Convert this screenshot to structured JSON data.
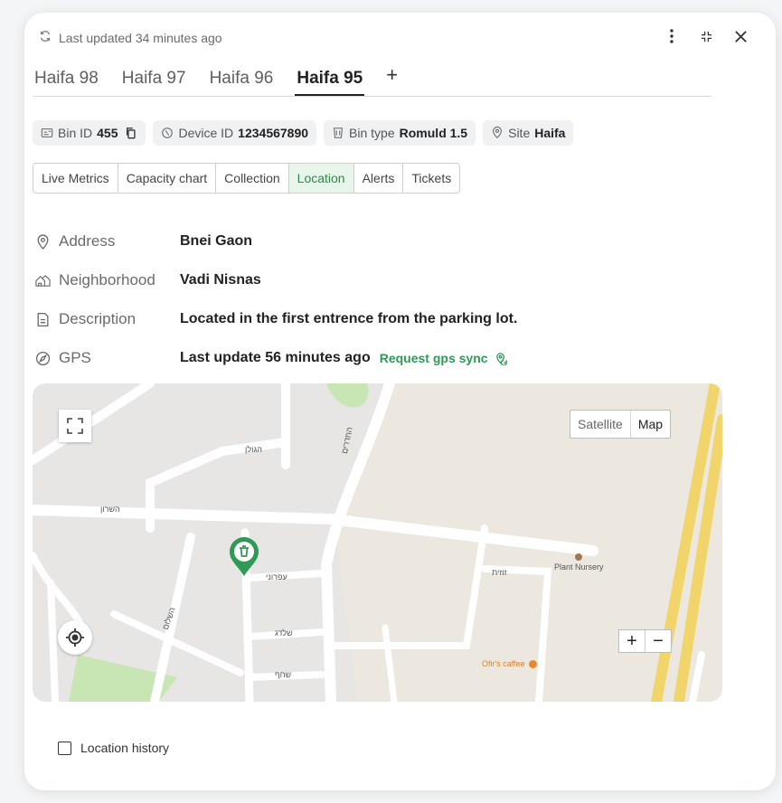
{
  "header": {
    "last_updated": "Last updated 34 minutes ago"
  },
  "tabs": [
    {
      "label": "Haifa 98"
    },
    {
      "label": "Haifa 97"
    },
    {
      "label": "Haifa 96"
    },
    {
      "label": "Haifa 95"
    }
  ],
  "tab_add_label": "+",
  "chips": {
    "bin_id_label": "Bin ID",
    "bin_id_value": "455",
    "device_id_label": "Device ID",
    "device_id_value": "1234567890",
    "bin_type_label": "Bin type",
    "bin_type_value": "Romuld 1.5",
    "site_label": "Site",
    "site_value": "Haifa"
  },
  "segments": [
    {
      "label": "Live Metrics"
    },
    {
      "label": "Capacity chart"
    },
    {
      "label": "Collection"
    },
    {
      "label": "Location"
    },
    {
      "label": "Alerts"
    },
    {
      "label": "Tickets"
    }
  ],
  "details": {
    "address_label": "Address",
    "address_value": "Bnei Gaon",
    "neighborhood_label": "Neighborhood",
    "neighborhood_value": "Vadi Nisnas",
    "description_label": "Description",
    "description_value": "Located in the first entrence from the parking lot.",
    "gps_label": "GPS",
    "gps_value": "Last update 56 minutes ago",
    "gps_sync_label": "Request gps sync"
  },
  "map": {
    "satellite_label": "Satellite",
    "map_label": "Map",
    "zoom_in": "+",
    "zoom_out": "−",
    "labels": {
      "plant_nursery": "Plant Nursery",
      "ofirs_caffee": "Ofir's caffee",
      "haddarim": "החדרים",
      "hasharon": "השרון",
      "hagolan": "הגולן",
      "shalom": "השלום",
      "shachaf": "שחף",
      "shaldag": "שלדג",
      "efroni": "עפרוני",
      "ezovit": "זוזית"
    }
  },
  "history_label": "Location history",
  "colors": {
    "accent": "#2e9a55",
    "map_pin": "#2e9a55"
  }
}
